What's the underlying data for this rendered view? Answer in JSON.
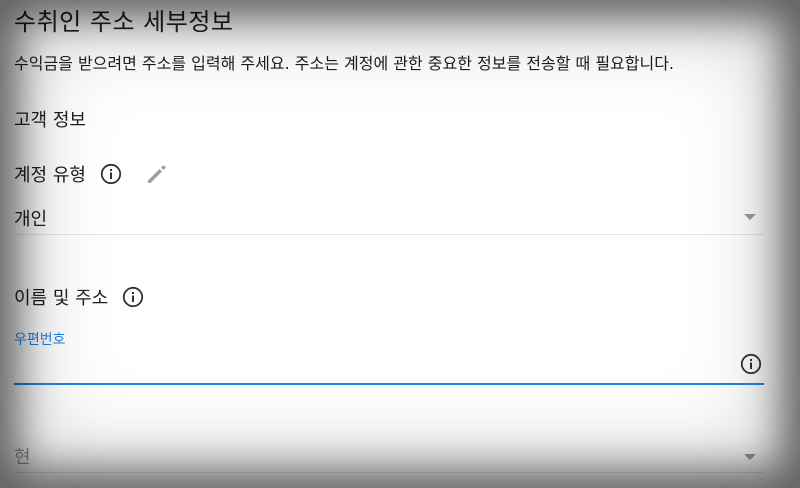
{
  "page": {
    "title": "수취인 주소 세부정보",
    "description": "수익금을 받으려면 주소를 입력해 주세요. 주소는 계정에 관한 중요한 정보를 전송할 때 필요합니다."
  },
  "customer_info": {
    "section_title": "고객 정보",
    "account_type": {
      "label": "계정 유형",
      "selected_value": "개인",
      "icons": [
        "info-icon",
        "pencil-icon",
        "dropdown-arrow-icon"
      ]
    },
    "name_address": {
      "label": "이름 및 주소",
      "postal_code": {
        "label": "우편번호",
        "value": ""
      },
      "state": {
        "placeholder": "현"
      }
    }
  },
  "colors": {
    "accent": "#1e88e5",
    "text": "#202020",
    "muted": "#9e9e9e",
    "divider": "#e6e6e6"
  }
}
